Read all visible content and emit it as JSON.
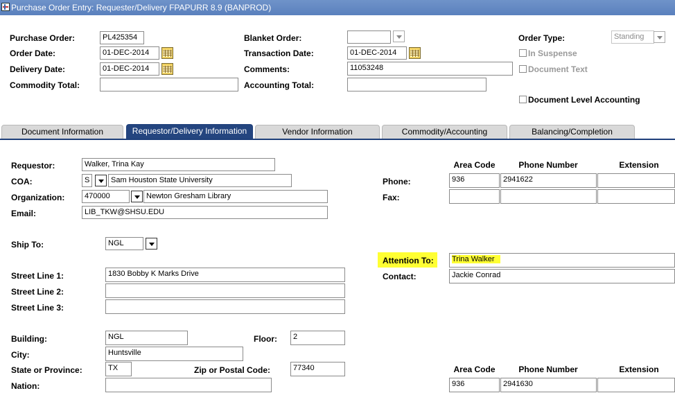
{
  "window": {
    "title": "Purchase Order Entry: Requester/Delivery  FPAPURR  8.9  (BANPROD)"
  },
  "header": {
    "purchase_order_label": "Purchase Order:",
    "purchase_order_value": "PL425354",
    "order_date_label": "Order Date:",
    "order_date_value": "01-DEC-2014",
    "delivery_date_label": "Delivery Date:",
    "delivery_date_value": "01-DEC-2014",
    "commodity_total_label": "Commodity Total:",
    "commodity_total_value": "",
    "blanket_order_label": "Blanket Order:",
    "blanket_order_value": "",
    "transaction_date_label": "Transaction Date:",
    "transaction_date_value": "01-DEC-2014",
    "comments_label": "Comments:",
    "comments_value": "11053248",
    "accounting_total_label": "Accounting Total:",
    "accounting_total_value": "",
    "order_type_label": "Order Type:",
    "order_type_value": "Standing",
    "in_suspense_label": "In Suspense",
    "document_text_label": "Document Text",
    "document_level_accounting_label": "Document Level Accounting"
  },
  "tabs": [
    {
      "label": "Document Information",
      "active": false
    },
    {
      "label": "Requestor/Delivery Information",
      "active": true
    },
    {
      "label": "Vendor Information",
      "active": false
    },
    {
      "label": "Commodity/Accounting",
      "active": false
    },
    {
      "label": "Balancing/Completion",
      "active": false
    }
  ],
  "requestor": {
    "requestor_label": "Requestor:",
    "requestor_value": "Walker, Trina Kay",
    "coa_label": "COA:",
    "coa_code": "S",
    "coa_name": "Sam Houston State University",
    "organization_label": "Organization:",
    "organization_code": "470000",
    "organization_name": "Newton Gresham Library",
    "email_label": "Email:",
    "email_value": "LIB_TKW@SHSU.EDU"
  },
  "phone_block": {
    "area_code_header": "Area Code",
    "phone_number_header": "Phone Number",
    "extension_header": "Extension",
    "phone_label": "Phone:",
    "phone_area": "936",
    "phone_number": "2941622",
    "phone_ext": "",
    "fax_label": "Fax:",
    "fax_area": "",
    "fax_number": "",
    "fax_ext": ""
  },
  "ship_to": {
    "ship_to_label": "Ship To:",
    "ship_to_value": "NGL",
    "street1_label": "Street Line 1:",
    "street1_value": "1830 Bobby K Marks Drive",
    "street2_label": "Street Line 2:",
    "street2_value": "",
    "street3_label": "Street Line 3:",
    "street3_value": "",
    "building_label": "Building:",
    "building_value": "NGL",
    "floor_label": "Floor:",
    "floor_value": "2",
    "city_label": "City:",
    "city_value": "Huntsville",
    "state_label": "State or Province:",
    "state_value": "TX",
    "zip_label": "Zip or Postal Code:",
    "zip_value": "77340",
    "nation_label": "Nation:",
    "nation_value": ""
  },
  "attention": {
    "attention_label": "Attention To:",
    "attention_value": "Trina Walker",
    "contact_label": "Contact:",
    "contact_value": "Jackie Conrad",
    "highlight_color": "#ffff33"
  },
  "ship_phone": {
    "area_code_header": "Area Code",
    "phone_number_header": "Phone Number",
    "extension_header": "Extension",
    "area": "936",
    "number": "2941630",
    "ext": ""
  }
}
